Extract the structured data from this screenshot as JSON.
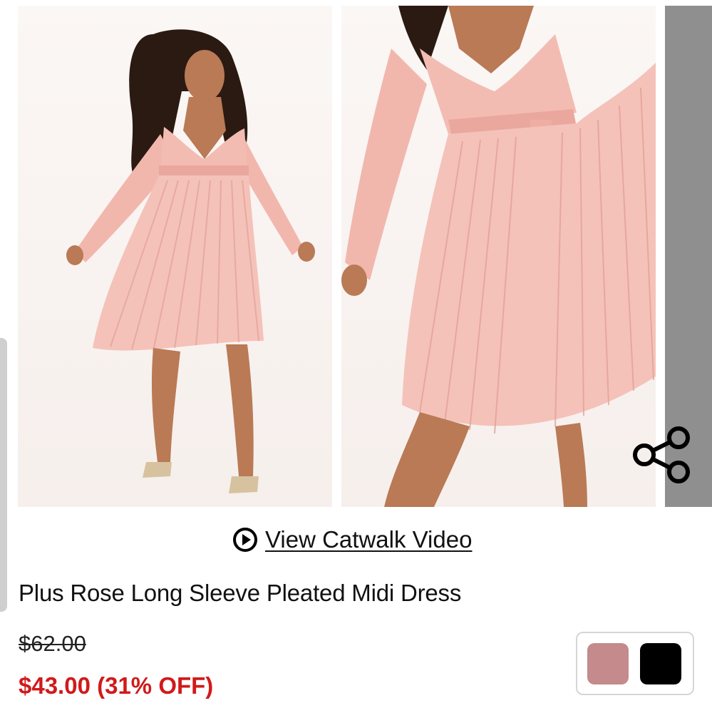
{
  "gallery": {
    "images": [
      {
        "alt_icon": "product-photo-front"
      },
      {
        "alt_icon": "product-photo-detail"
      },
      {
        "alt_icon": "product-photo-next"
      }
    ],
    "share_icon": "share-icon"
  },
  "video": {
    "icon": "play-circle-icon",
    "label": "View Catwalk Video"
  },
  "product": {
    "title": "Plus Rose Long Sleeve Pleated Midi Dress",
    "old_price": "$62.00",
    "price": "$43.00",
    "discount": "(31% OFF)"
  },
  "colors": {
    "accent_price": "#d11a1a",
    "swatches": [
      {
        "name": "rose",
        "color": "#c48a8c"
      },
      {
        "name": "black",
        "color": "#000000"
      }
    ]
  }
}
